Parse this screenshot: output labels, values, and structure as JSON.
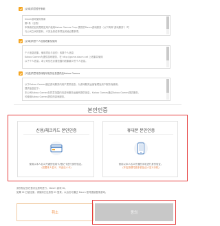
{
  "terms": [
    {
      "checkbox_label": "[必填]同意遵守条款",
      "lines": [
        "Daum游戏使用条款",
        "第1条（目的）",
        "本条款的目的是规定用户使用Kakao Games Corp.提供的Daum游戏服务（以下简称\"游戏服务\"）时",
        "与公司之间的权利、义务及责任事项及其他必要事项。"
      ]
    },
    {
      "checkbox_label": "[必填]同意个人信息收集及使用",
      "lines": [
        "",
        "个人信息收集、使用项目与目的：收集个人信息",
        "Kakao Games为提供游戏服务，在 http://game.daum.net 上收集并使用",
        "以下个人信息。本公司仅在必要范围内收集最少的个人信息。"
      ]
    },
    {
      "checkbox_label": "[可选]同意将游戏账号相关信息提供给Kakao Games",
      "lines": [
        "",
        "以下Kakao Games通过游戏服务向用户提供信息，为游戏服务运营管理及用户服务而使用，",
        "提供信息如下：",
        "本公司Kakao Games在同意范围内向游戏服务运营商提供信息，Kakao Games通过Kakao Games提供服务，",
        "可使用Kakao Games提供的游戏服务。"
      ]
    }
  ],
  "verification": {
    "title": "본인인증",
    "cards": [
      {
        "title": "신용/체크카드 본인인증",
        "desc": "使用以本人名义开通的信用卡/借记卡进行身份验证。",
        "note": "(仅限本人名义，不含法人卡)"
      },
      {
        "title": "휴대폰 본인인증",
        "desc": "使用以本人名义开通的手机进行身份验证。",
        "note": "(不支持预付费手机及法人名义手机)"
      }
    ]
  },
  "footer_note": [
    "身份验证仅在首次注册时进行，Daum 游戏 ID。",
    "如果 ID 已被注册，请使用已注册的 ID 登录，以后也可通过 Daum 账号直接登录游戏。"
  ],
  "buttons": {
    "cancel": "취소",
    "confirm": "동의"
  },
  "colors": {
    "accent": "#f5a623",
    "highlight_frame": "#e53b3b",
    "confirm_button": "#c8c8c8"
  }
}
